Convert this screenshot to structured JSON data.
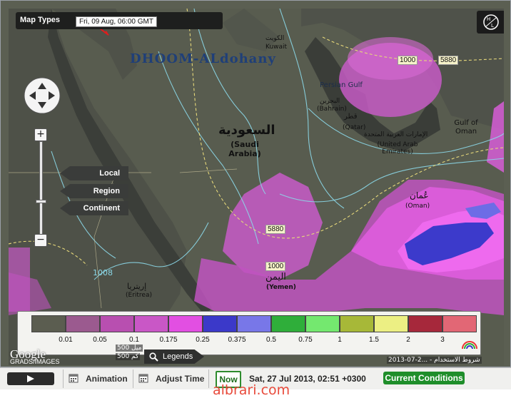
{
  "map": {
    "map_types_label": "Map Types",
    "forecast_time": "Fri, 09 Aug, 06:00 GMT",
    "watermark_title": "DHOOM-ALdohany",
    "hl_toggle_icon": "hl-toggle-icon",
    "scale_buttons": [
      {
        "label": "Local"
      },
      {
        "label": "Region"
      },
      {
        "label": "Continent"
      }
    ],
    "legend": {
      "swatch_colors": [
        "#5b5d50",
        "#9b5a8f",
        "#b84fb0",
        "#c957c6",
        "#e24fe2",
        "#3b39c9",
        "#7877e8",
        "#2fae3a",
        "#74e86f",
        "#a7b838",
        "#ecef83",
        "#a6283b",
        "#e26775"
      ],
      "ticks": [
        "0.01",
        "0.05",
        "0.1",
        "0.175",
        "0.25",
        "0.375",
        "0.5",
        "0.75",
        "1",
        "1.5",
        "2",
        "3"
      ]
    },
    "legends_button": "Legends",
    "google_logo": "Google",
    "map_credit": "GRADS/IMAGES",
    "copyright": "2013-07-2... - شروط الاستخدام",
    "scale_labels": [
      "500 ميل",
      "500 كم"
    ],
    "contour_labels": [
      "1000",
      "5880",
      "5880",
      "1000",
      "1008"
    ],
    "place_labels": [
      {
        "name": "Kuwait",
        "arabic": "الكويت"
      },
      {
        "name": "Persian Gulf",
        "arabic": ""
      },
      {
        "name": "(Bahrain)",
        "arabic": "البحرين"
      },
      {
        "name": "(Qatar)",
        "arabic": "قطر"
      },
      {
        "name": "(United Arab Emirates)",
        "arabic": "الإمارات العربية المتحدة"
      },
      {
        "name": "Gulf of Oman",
        "arabic": ""
      },
      {
        "name": "(Saudi Arabia)",
        "arabic": "السعودية"
      },
      {
        "name": "(Oman)",
        "arabic": "عُمان"
      },
      {
        "name": "(Yemen)",
        "arabic": "اليمن"
      },
      {
        "name": "(Eritrea)",
        "arabic": "إريتريا"
      }
    ]
  },
  "toolbar": {
    "animation_label": "Animation",
    "adjust_time_label": "Adjust Time",
    "now_label": "Now",
    "current_datetime": "Sat, 27 Jul 2013, 02:51 +0300",
    "current_conditions_label": "Current Conditions"
  },
  "footer": {
    "watermark": "albrari.com"
  }
}
